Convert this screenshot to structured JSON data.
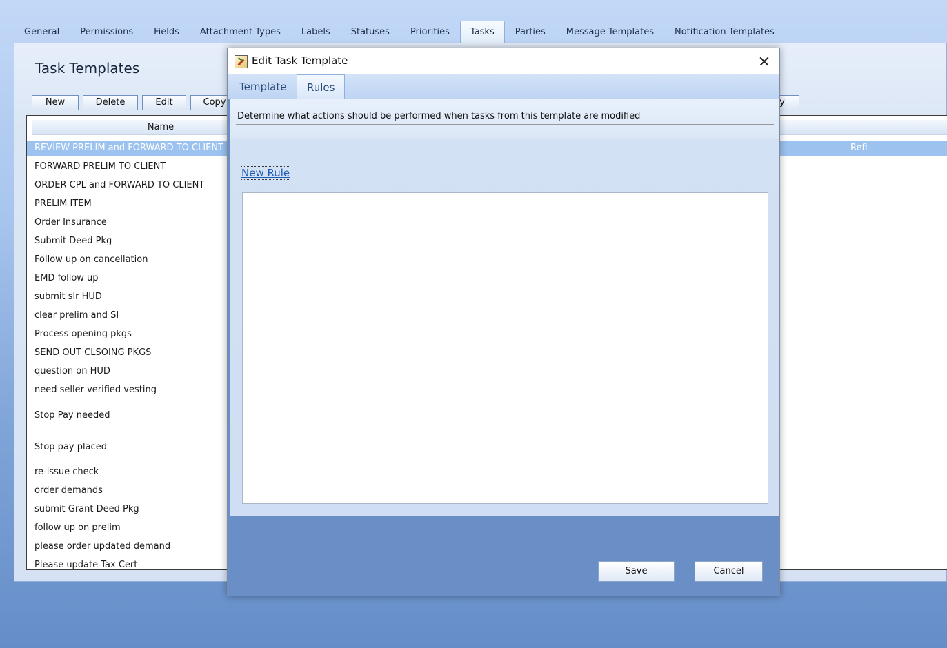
{
  "main_tabs": [
    {
      "label": "General"
    },
    {
      "label": "Permissions"
    },
    {
      "label": "Fields"
    },
    {
      "label": "Attachment Types"
    },
    {
      "label": "Labels"
    },
    {
      "label": "Statuses"
    },
    {
      "label": "Priorities"
    },
    {
      "label": "Tasks",
      "active": true
    },
    {
      "label": "Parties"
    },
    {
      "label": "Message Templates"
    },
    {
      "label": "Notification Templates"
    }
  ],
  "back_panel": {
    "title": "Task Templates",
    "toolbar": {
      "new_label": "New",
      "delete_label": "Delete",
      "edit_label": "Edit",
      "copy_label": "Copy",
      "partial_right_label": "y"
    },
    "grid": {
      "name_header": "Name",
      "selected_row_extra": "Refi",
      "rows": [
        "REVIEW PRELIM and FORWARD TO CLIENT",
        "FORWARD PRELIM TO CLIENT",
        "ORDER CPL  and FORWARD TO CLIENT",
        "PRELIM ITEM",
        "Order Insurance",
        "Submit Deed Pkg",
        "Follow up on cancellation",
        "EMD follow up",
        "submit slr HUD",
        "clear prelim and SI",
        "Process opening pkgs",
        "SEND OUT CLSOING PKGS",
        "question on HUD",
        "need seller verified vesting",
        "Stop Pay needed",
        "Stop pay placed",
        "re-issue check",
        "order demands",
        "submit Grant Deed Pkg",
        "follow up on prelim",
        "please order updated demand",
        "Please update Tax Cert"
      ]
    }
  },
  "modal": {
    "title": "Edit Task Template",
    "tabs": {
      "template_label": "Template",
      "rules_label": "Rules"
    },
    "description": "Determine what actions should be performed when tasks from this template are modified",
    "new_rule_label": "New Rule",
    "save_label": "Save",
    "cancel_label": "Cancel"
  },
  "colors": {
    "selected_row": "#9cc2ef",
    "link": "#1f5bb5",
    "modal_footer": "#6a8fc7"
  },
  "icons": {
    "app_icon": "task-template-icon",
    "close_icon": "close-icon"
  }
}
